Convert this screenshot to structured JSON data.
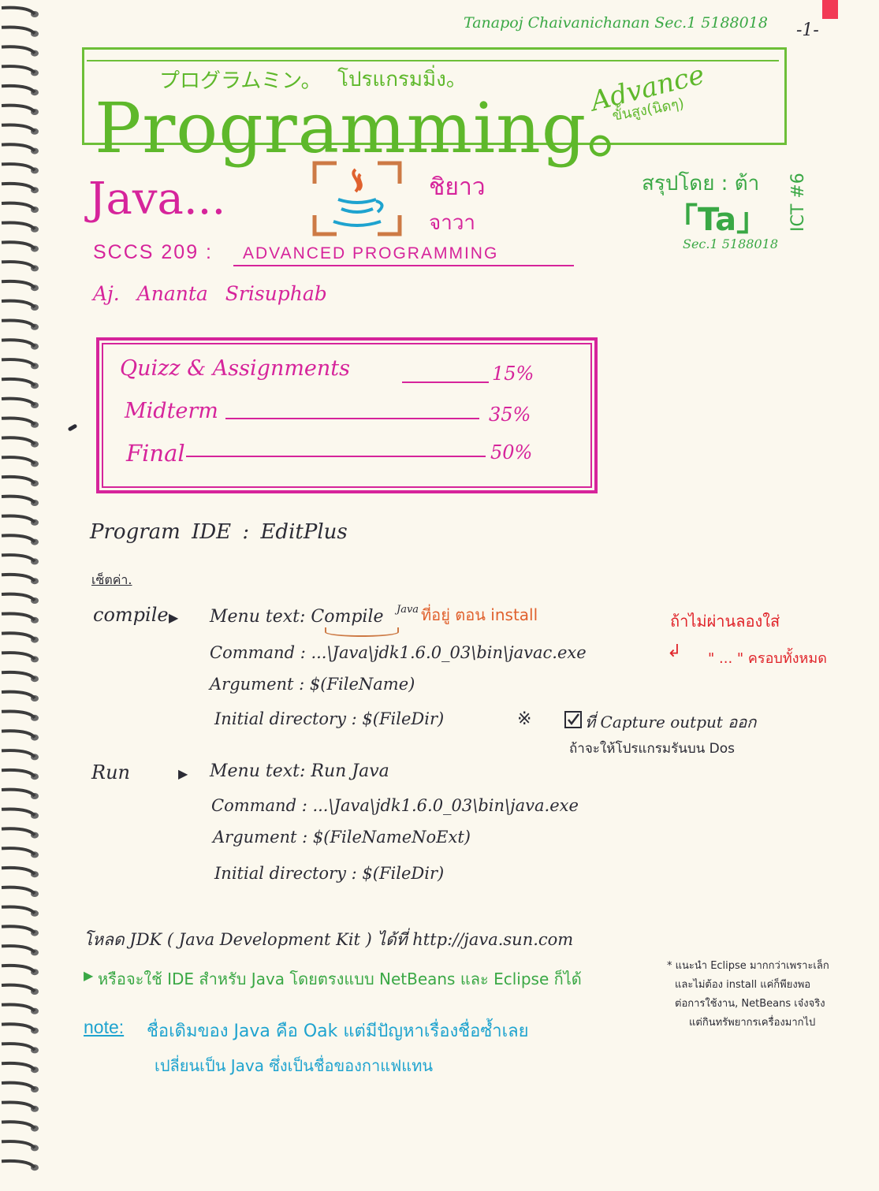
{
  "header": {
    "author": "Tanapoj Chaivanichanan Sec.1 5188018",
    "page_number": "-1-"
  },
  "title": {
    "katakana": "プログラムミン。",
    "thai_phonetic": "โปรแกรมมิ่ง。",
    "main": "Programming。",
    "advance": "Advance",
    "advance_thai": "ขั้นสูง(นิดๆ)"
  },
  "java": {
    "heading": "Java...",
    "thai_1": "ชิยาว",
    "thai_2": "จาวา"
  },
  "summary": {
    "by": "สรุปโดย : ต้า",
    "name": "「Ta」",
    "sec": "Sec.1 5188018",
    "ict": "ICT #6"
  },
  "course": {
    "code": "SCCS 209 :",
    "name": "ADVANCED PROGRAMMING",
    "teacher": "Aj. Ananta Srisuphab"
  },
  "grading": [
    {
      "label": "Quizz & Assignments",
      "value": "15%"
    },
    {
      "label": "Midterm",
      "value": "35%"
    },
    {
      "label": "Final",
      "value": "50%"
    }
  ],
  "ide": {
    "title": "Program IDE : EditPlus",
    "settings": "เซ็ตค่า.",
    "compile_label": "compile",
    "compile_menu_text": "Menu text: Compile",
    "compile_menu_java": "Java",
    "compile_note": "ที่อยู่ ตอน install",
    "path_note": "ถ้าไม่ผ่านลองใส่",
    "quote_note": "\" ... \" ครอบทั้งหมด",
    "compile_command": "Command : ...\\Java\\jdk1.6.0_03\\bin\\javac.exe",
    "compile_argument": "Argument : $(FileName)",
    "compile_initdir": "Initial directory : $(FileDir)",
    "capture_note_mark": "※",
    "capture_note_1": "ที่ Capture output ออก",
    "capture_note_2": "ถ้าจะให้โปรแกรมรันบน Dos",
    "run_label": "Run",
    "run_menu_text": "Menu text: Run Java",
    "run_command": "Command : ...\\Java\\jdk1.6.0_03\\bin\\java.exe",
    "run_argument": "Argument : $(FileNameNoExt)",
    "run_initdir": "Initial directory : $(FileDir)"
  },
  "download": {
    "text": "โหลด JDK ( Java Development Kit ) ได้ที่ http://java.sun.com",
    "alt": "หรือจะใช้ IDE สำหรับ Java โดยตรงแบบ NetBeans และ Eclipse ก็ได้"
  },
  "side_note": [
    "* แนะนำ Eclipse มากกว่าเพราะเล็ก",
    "และไม่ต้อง install แค่ก็พียงพอ",
    "ต่อการใช้งาน, NetBeans เจ๋งจริง",
    "แต่กินทรัพยากรเครื่องมากไป"
  ],
  "note": {
    "label": "note:",
    "line1": "ชื่อเดิมของ Java คือ Oak แต่มีปัญหาเรื่องชื่อซ้ำเลย",
    "line2": "เปลี่ยนเป็น Java ซึ่งเป็นชื่อของกาแฟแทน"
  },
  "colors": {
    "pink": "#d6249b",
    "green": "#5eb82b",
    "orange": "#e0612e",
    "cyan": "#1ea3cf",
    "ink": "#2b2b35"
  }
}
